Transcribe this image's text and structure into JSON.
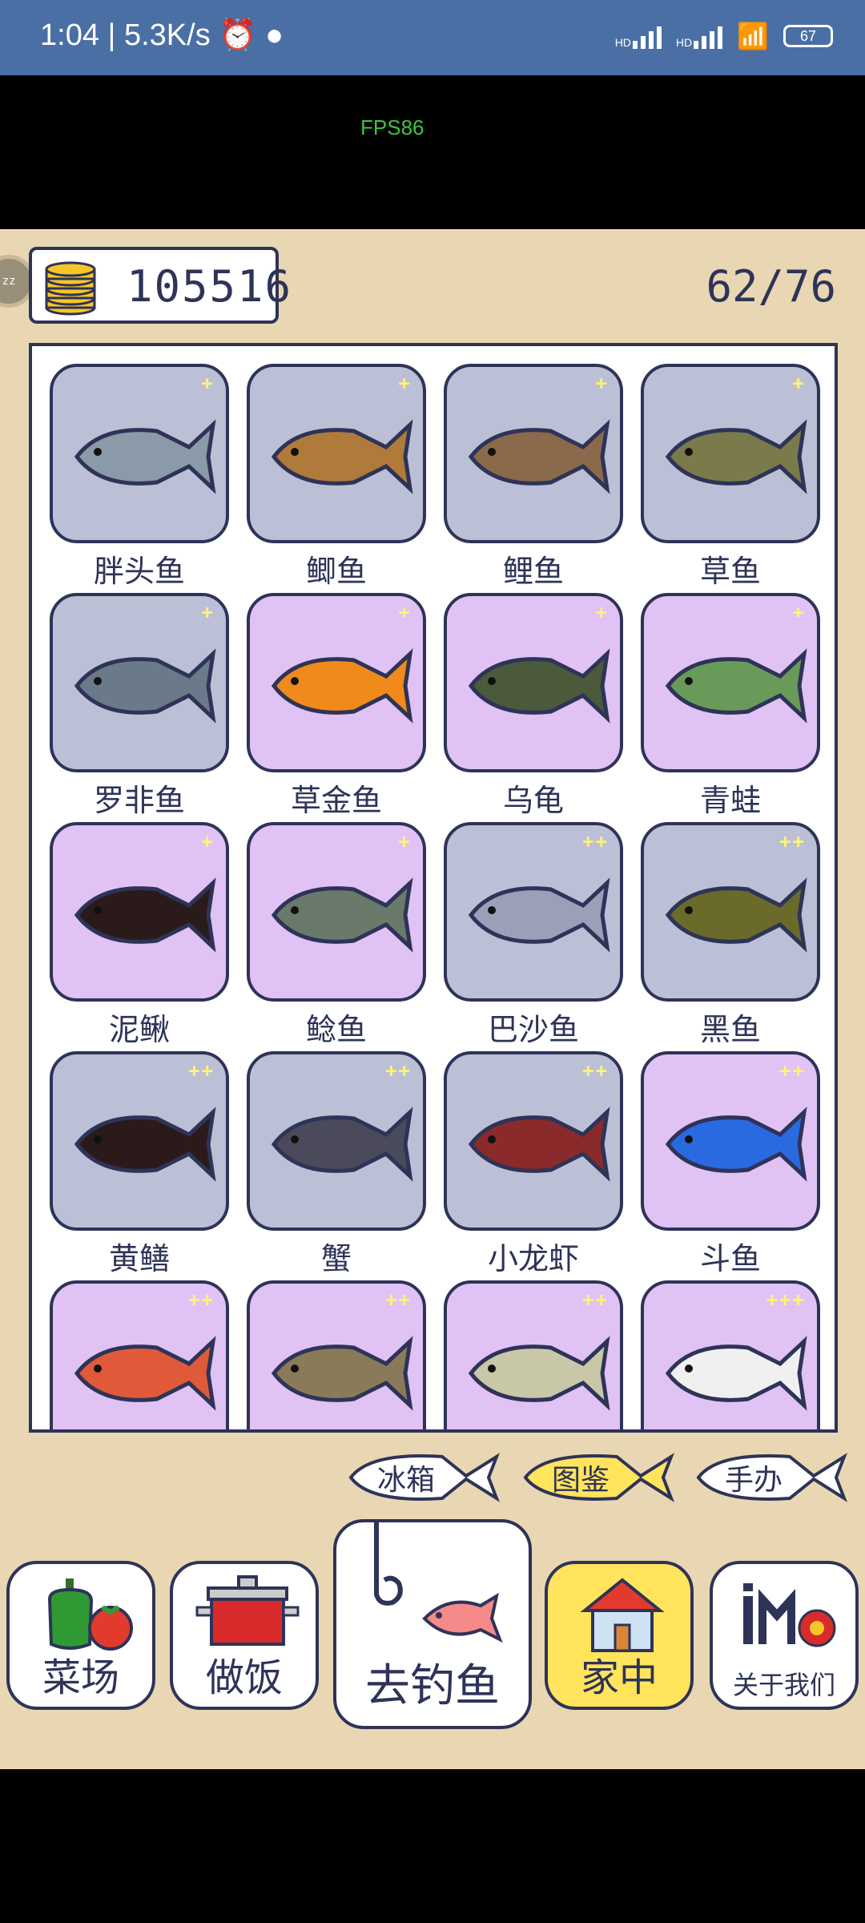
{
  "status_bar": {
    "time": "1:04",
    "net_speed": "5.3K/s",
    "signal_label": "HD",
    "battery": "67"
  },
  "fps": "FPS86",
  "side_avatar": "zz",
  "coins": "105516",
  "collection_progress": "62/76",
  "fish": [
    {
      "name": "胖头鱼",
      "stars": "+",
      "bg": "gray",
      "icon": "bighead-carp-icon"
    },
    {
      "name": "鲫鱼",
      "stars": "+",
      "bg": "gray",
      "icon": "crucian-carp-icon"
    },
    {
      "name": "鲤鱼",
      "stars": "+",
      "bg": "gray",
      "icon": "carp-icon"
    },
    {
      "name": "草鱼",
      "stars": "+",
      "bg": "gray",
      "icon": "grass-carp-icon"
    },
    {
      "name": "罗非鱼",
      "stars": "+",
      "bg": "gray",
      "icon": "tilapia-icon"
    },
    {
      "name": "草金鱼",
      "stars": "+",
      "bg": "purple",
      "icon": "goldfish-icon"
    },
    {
      "name": "乌龟",
      "stars": "+",
      "bg": "purple",
      "icon": "tortoise-icon"
    },
    {
      "name": "青蛙",
      "stars": "+",
      "bg": "purple",
      "icon": "frog-icon"
    },
    {
      "name": "泥鳅",
      "stars": "+",
      "bg": "purple",
      "icon": "loach-icon"
    },
    {
      "name": "鲶鱼",
      "stars": "+",
      "bg": "purple",
      "icon": "catfish-icon"
    },
    {
      "name": "巴沙鱼",
      "stars": "++",
      "bg": "gray",
      "icon": "basa-fish-icon"
    },
    {
      "name": "黑鱼",
      "stars": "++",
      "bg": "gray",
      "icon": "snakehead-icon"
    },
    {
      "name": "黄鳝",
      "stars": "++",
      "bg": "gray",
      "icon": "eel-icon"
    },
    {
      "name": "蟹",
      "stars": "++",
      "bg": "gray",
      "icon": "crab-icon"
    },
    {
      "name": "小龙虾",
      "stars": "++",
      "bg": "gray",
      "icon": "crayfish-icon"
    },
    {
      "name": "斗鱼",
      "stars": "++",
      "bg": "purple",
      "icon": "betta-icon"
    },
    {
      "name": "",
      "stars": "++",
      "bg": "purple",
      "icon": "guppy-icon"
    },
    {
      "name": "",
      "stars": "++",
      "bg": "purple",
      "icon": "softshell-turtle-icon"
    },
    {
      "name": "",
      "stars": "++",
      "bg": "purple",
      "icon": "pufferfish-icon"
    },
    {
      "name": "",
      "stars": "+++",
      "bg": "purple",
      "icon": "koi-icon"
    }
  ],
  "tabs": [
    {
      "label": "冰箱",
      "active": false
    },
    {
      "label": "图鉴",
      "active": true
    },
    {
      "label": "手办",
      "active": false
    }
  ],
  "nav": [
    {
      "label": "菜场",
      "icon": "vegetables-icon"
    },
    {
      "label": "做饭",
      "icon": "cooking-pot-icon"
    },
    {
      "label": "去钓鱼",
      "icon": "fishing-hook-icon"
    },
    {
      "label": "家中",
      "icon": "house-icon",
      "active": true
    },
    {
      "label": "关于我们",
      "icon": "about-us-icon"
    }
  ],
  "colors": {
    "gray_card": "#bcc0d6",
    "purple_card": "#e0c2f5",
    "outline": "#2e3358",
    "active_tab": "#ffe45c",
    "game_bg": "#e8d7b2",
    "status_bar": "#4a6fa5"
  }
}
